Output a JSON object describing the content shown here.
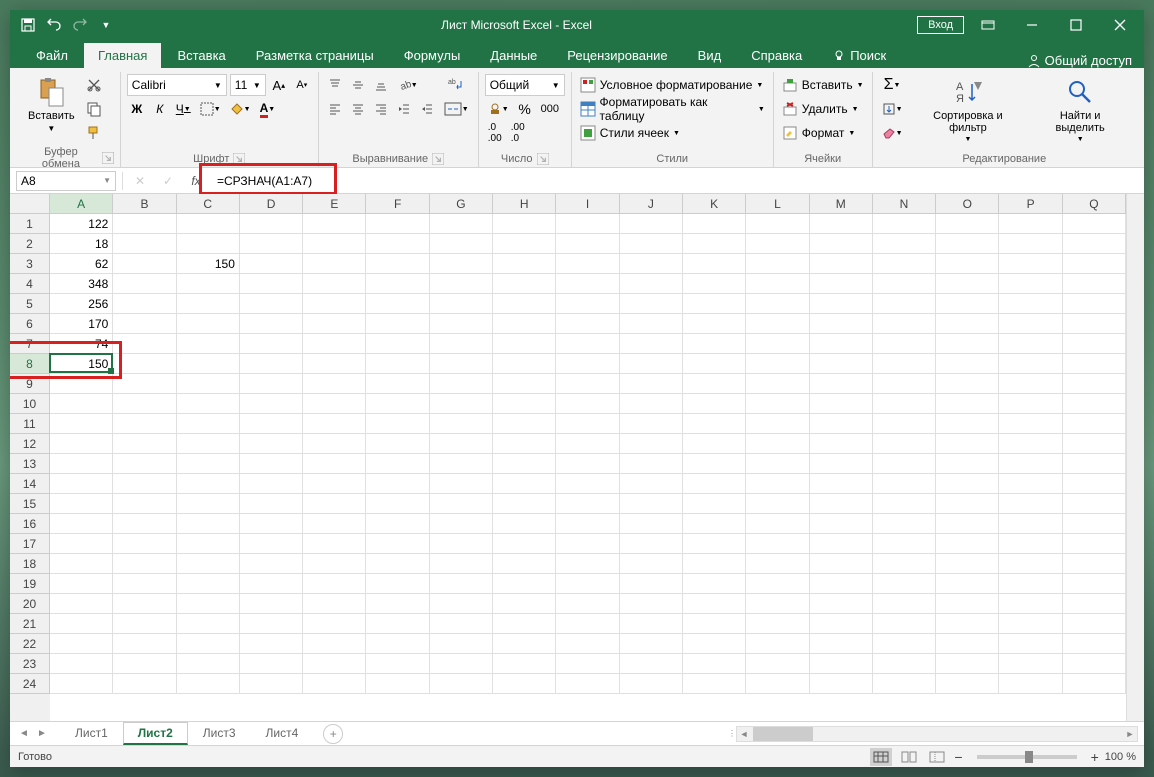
{
  "title": "Лист Microsoft Excel  -  Excel",
  "login": "Вход",
  "menu": {
    "file": "Файл",
    "home": "Главная",
    "insert": "Вставка",
    "pagelayout": "Разметка страницы",
    "formulas": "Формулы",
    "data": "Данные",
    "review": "Рецензирование",
    "view": "Вид",
    "help": "Справка",
    "search": "Поиск",
    "share": "Общий доступ"
  },
  "ribbon": {
    "paste": "Вставить",
    "clipboard_label": "Буфер обмена",
    "font_name": "Calibri",
    "font_size": "11",
    "font_label": "Шрифт",
    "align_label": "Выравнивание",
    "number_format": "Общий",
    "number_label": "Число",
    "cond_format": "Условное форматирование",
    "format_table": "Форматировать как таблицу",
    "cell_styles": "Стили ячеек",
    "styles_label": "Стили",
    "insert_btn": "Вставить",
    "delete_btn": "Удалить",
    "format_btn": "Формат",
    "cells_label": "Ячейки",
    "sort": "Сортировка и фильтр",
    "find": "Найти и выделить",
    "editing_label": "Редактирование"
  },
  "name_box": "A8",
  "formula": "=СРЗНАЧ(A1:A7)",
  "columns": [
    "A",
    "B",
    "C",
    "D",
    "E",
    "F",
    "G",
    "H",
    "I",
    "J",
    "K",
    "L",
    "M",
    "N",
    "O",
    "P",
    "Q"
  ],
  "row_count": 24,
  "active_row": 8,
  "active_col": "A",
  "cells": {
    "A1": "122",
    "A2": "18",
    "A3": "62",
    "C3": "150",
    "A4": "348",
    "A5": "256",
    "A6": "170",
    "A7": "74",
    "A8": "150"
  },
  "sheets": [
    "Лист1",
    "Лист2",
    "Лист3",
    "Лист4"
  ],
  "active_sheet": "Лист2",
  "status": "Готово",
  "zoom": "100 %"
}
